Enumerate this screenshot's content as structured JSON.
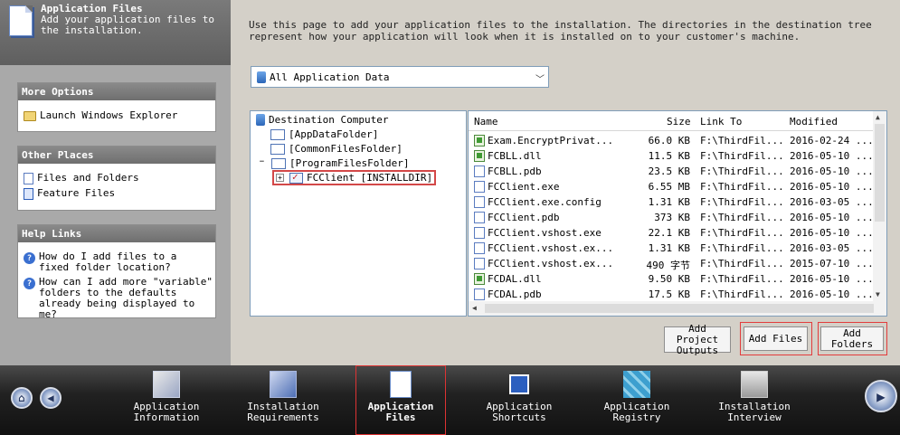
{
  "header": {
    "title": "Application Files",
    "subtitle": "Add your application files to the installation."
  },
  "sidebar": {
    "more_options": {
      "title": "More Options",
      "items": [
        {
          "label": "Launch Windows Explorer",
          "icon": "folder-open-icon"
        }
      ]
    },
    "other_places": {
      "title": "Other Places",
      "items": [
        {
          "label": "Files and Folders",
          "icon": "file-icon"
        },
        {
          "label": "Feature Files",
          "icon": "feature-file-icon"
        }
      ]
    },
    "help_links": {
      "title": "Help Links",
      "items": [
        {
          "label": "How do I add files to a fixed folder location?"
        },
        {
          "label": "How can I add more \"variable\" folders to the defaults already being displayed to me?"
        }
      ]
    }
  },
  "main": {
    "description": "Use this page to add your application files to the installation. The directories in the destination tree represent how your application will look when it is installed on to your customer's machine.",
    "filter_dropdown": "All Application Data",
    "tree": {
      "root": "Destination Computer",
      "children": [
        "[AppDataFolder]",
        "[CommonFilesFolder]",
        "[ProgramFilesFolder]"
      ],
      "selected": "FCClient [INSTALLDIR]"
    },
    "list": {
      "columns": [
        "Name",
        "Size",
        "Link To",
        "Modified"
      ],
      "rows": [
        {
          "name": "Exam.EncryptPrivat...",
          "size": "66.0 KB",
          "link": "F:\\ThirdFil...",
          "modified": "2016-02-24 ...",
          "type": "dll"
        },
        {
          "name": "FCBLL.dll",
          "size": "11.5 KB",
          "link": "F:\\ThirdFil...",
          "modified": "2016-05-10 ...",
          "type": "dll"
        },
        {
          "name": "FCBLL.pdb",
          "size": "23.5 KB",
          "link": "F:\\ThirdFil...",
          "modified": "2016-05-10 ...",
          "type": "file"
        },
        {
          "name": "FCClient.exe",
          "size": "6.55 MB",
          "link": "F:\\ThirdFil...",
          "modified": "2016-05-10 ...",
          "type": "exe"
        },
        {
          "name": "FCClient.exe.config",
          "size": "1.31 KB",
          "link": "F:\\ThirdFil...",
          "modified": "2016-03-05 ...",
          "type": "file"
        },
        {
          "name": "FCClient.pdb",
          "size": "373 KB",
          "link": "F:\\ThirdFil...",
          "modified": "2016-05-10 ...",
          "type": "file"
        },
        {
          "name": "FCClient.vshost.exe",
          "size": "22.1 KB",
          "link": "F:\\ThirdFil...",
          "modified": "2016-05-10 ...",
          "type": "exe"
        },
        {
          "name": "FCClient.vshost.ex...",
          "size": "1.31 KB",
          "link": "F:\\ThirdFil...",
          "modified": "2016-03-05 ...",
          "type": "file"
        },
        {
          "name": "FCClient.vshost.ex...",
          "size": "490 字节",
          "link": "F:\\ThirdFil...",
          "modified": "2015-07-10 ...",
          "type": "file"
        },
        {
          "name": "FCDAL.dll",
          "size": "9.50 KB",
          "link": "F:\\ThirdFil...",
          "modified": "2016-05-10 ...",
          "type": "dll"
        },
        {
          "name": "FCDAL.pdb",
          "size": "17.5 KB",
          "link": "F:\\ThirdFil...",
          "modified": "2016-05-10 ...",
          "type": "file"
        }
      ]
    },
    "buttons": {
      "add_project_outputs": "Add Project Outputs",
      "add_files": "Add Files",
      "add_folders": "Add Folders"
    }
  },
  "bottom_nav": {
    "items": [
      {
        "label": "Application Information",
        "icon": "application-information-icon"
      },
      {
        "label": "Installation Requirements",
        "icon": "installation-requirements-icon"
      },
      {
        "label": "Application Files",
        "icon": "application-files-icon"
      },
      {
        "label": "Application Shortcuts",
        "icon": "application-shortcuts-icon"
      },
      {
        "label": "Application Registry",
        "icon": "application-registry-icon"
      },
      {
        "label": "Installation Interview",
        "icon": "installation-interview-icon"
      }
    ],
    "home_icon": "home-icon",
    "back_icon": "back-arrow-icon",
    "next_icon": "next-arrow-icon"
  }
}
